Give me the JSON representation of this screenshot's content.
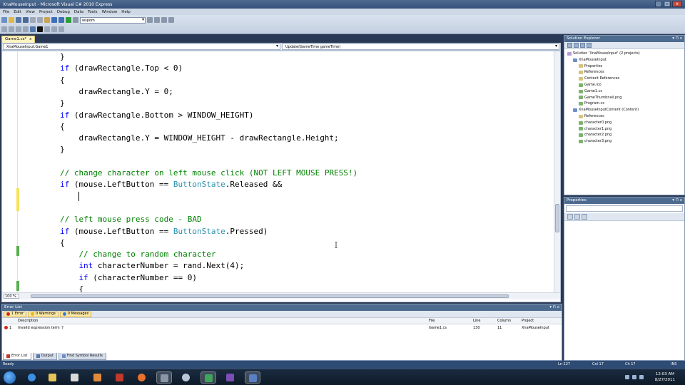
{
  "window": {
    "title": "XnaMouseInput - Microsoft Visual C# 2010 Express",
    "controls": [
      "_",
      "□",
      "x"
    ]
  },
  "menu": [
    "File",
    "Edit",
    "View",
    "Project",
    "Debug",
    "Data",
    "Tools",
    "Window",
    "Help"
  ],
  "toolbar": {
    "config_combo": "wspom"
  },
  "editor": {
    "tab_label": "Game1.cs*",
    "tab_close": "x",
    "nav_left": "XnaMouseInput.Game1",
    "nav_right": "Update(GameTime gameTime)",
    "zoom": "100 %",
    "lines": [
      {
        "indent": 8,
        "parts": [
          {
            "t": "}",
            "c": ""
          }
        ]
      },
      {
        "indent": 8,
        "parts": [
          {
            "t": "if",
            "c": "kw"
          },
          {
            "t": " (drawRectangle.Top < 0)",
            "c": ""
          }
        ]
      },
      {
        "indent": 8,
        "parts": [
          {
            "t": "{",
            "c": ""
          }
        ]
      },
      {
        "indent": 12,
        "parts": [
          {
            "t": "drawRectangle.Y = 0;",
            "c": ""
          }
        ]
      },
      {
        "indent": 8,
        "parts": [
          {
            "t": "}",
            "c": ""
          }
        ]
      },
      {
        "indent": 8,
        "parts": [
          {
            "t": "if",
            "c": "kw"
          },
          {
            "t": " (drawRectangle.Bottom > WINDOW_HEIGHT)",
            "c": ""
          }
        ]
      },
      {
        "indent": 8,
        "parts": [
          {
            "t": "{",
            "c": ""
          }
        ]
      },
      {
        "indent": 12,
        "parts": [
          {
            "t": "drawRectangle.Y = WINDOW_HEIGHT - drawRectangle.Height;",
            "c": ""
          }
        ]
      },
      {
        "indent": 8,
        "parts": [
          {
            "t": "}",
            "c": ""
          }
        ]
      },
      {
        "indent": 0,
        "parts": []
      },
      {
        "indent": 8,
        "parts": [
          {
            "t": "// change character on left mouse click (NOT LEFT MOUSE PRESS!)",
            "c": "cm"
          }
        ]
      },
      {
        "indent": 8,
        "parts": [
          {
            "t": "if",
            "c": "kw"
          },
          {
            "t": " (mouse.LeftButton == ",
            "c": ""
          },
          {
            "t": "ButtonState",
            "c": "ty"
          },
          {
            "t": ".Released &&",
            "c": ""
          }
        ]
      },
      {
        "indent": 12,
        "parts": [],
        "caret": true
      },
      {
        "indent": 0,
        "parts": []
      },
      {
        "indent": 8,
        "parts": [
          {
            "t": "// left mouse press code - BAD",
            "c": "cm"
          }
        ]
      },
      {
        "indent": 8,
        "parts": [
          {
            "t": "if",
            "c": "kw"
          },
          {
            "t": " (mouse.LeftButton == ",
            "c": ""
          },
          {
            "t": "ButtonState",
            "c": "ty"
          },
          {
            "t": ".Pressed)",
            "c": ""
          }
        ]
      },
      {
        "indent": 8,
        "parts": [
          {
            "t": "{",
            "c": ""
          }
        ]
      },
      {
        "indent": 12,
        "parts": [
          {
            "t": "// change to random character",
            "c": "cm"
          }
        ]
      },
      {
        "indent": 12,
        "parts": [
          {
            "t": "int",
            "c": "kw"
          },
          {
            "t": " characterNumber = rand.Next(4);",
            "c": ""
          }
        ]
      },
      {
        "indent": 12,
        "parts": [
          {
            "t": "if",
            "c": "kw"
          },
          {
            "t": " (characterNumber == 0)",
            "c": ""
          }
        ]
      },
      {
        "indent": 12,
        "parts": [
          {
            "t": "{",
            "c": ""
          }
        ]
      }
    ]
  },
  "solution_explorer": {
    "title": "Solution Explorer",
    "pin": "▾ ⊓ x",
    "items": [
      {
        "label": "Solution 'XnaMouseInput' (2 projects)",
        "indent": 0,
        "color": "#b69cd6"
      },
      {
        "label": "XnaMouseInput",
        "indent": 1,
        "color": "#6d8fc9"
      },
      {
        "label": "Properties",
        "indent": 2,
        "color": "#d8c27a"
      },
      {
        "label": "References",
        "indent": 2,
        "color": "#d8c27a"
      },
      {
        "label": "Content References",
        "indent": 2,
        "color": "#d8c27a"
      },
      {
        "label": "Game.ico",
        "indent": 2,
        "color": "#7bb36b"
      },
      {
        "label": "Game1.cs",
        "indent": 2,
        "color": "#7bb36b"
      },
      {
        "label": "GameThumbnail.png",
        "indent": 2,
        "color": "#7bb36b"
      },
      {
        "label": "Program.cs",
        "indent": 2,
        "color": "#7bb36b"
      },
      {
        "label": "XnaMouseInputContent (Content)",
        "indent": 1,
        "color": "#6d8fc9"
      },
      {
        "label": "References",
        "indent": 2,
        "color": "#d8c27a"
      },
      {
        "label": "character0.png",
        "indent": 2,
        "color": "#7bb36b"
      },
      {
        "label": "character1.png",
        "indent": 2,
        "color": "#7bb36b"
      },
      {
        "label": "character2.png",
        "indent": 2,
        "color": "#7bb36b"
      },
      {
        "label": "character3.png",
        "indent": 2,
        "color": "#7bb36b"
      }
    ]
  },
  "properties": {
    "title": "Properties",
    "pin": "▾ ⊓ x"
  },
  "error_list": {
    "title": "Error List",
    "pin": "▾ ⊓ x",
    "filters": [
      {
        "label": "1 Error",
        "color": "#d7261d",
        "active": true
      },
      {
        "label": "0 Warnings",
        "color": "#e8b923",
        "active": true
      },
      {
        "label": "0 Messages",
        "color": "#3a7fd4",
        "active": true
      }
    ],
    "columns": [
      "Description",
      "File",
      "Line",
      "Column",
      "Project"
    ],
    "rows": [
      {
        "num": "1",
        "description": "Invalid expression term ')'",
        "file": "Game1.cs",
        "line": "130",
        "column": "11",
        "project": "XnaMouseInput"
      }
    ]
  },
  "bottom_tabs": [
    "Error List",
    "Output",
    "Find Symbol Results"
  ],
  "status": {
    "left": "Ready",
    "ln": "Ln 127",
    "col": "Col 17",
    "ch": "Ch 17",
    "mode": "INS"
  },
  "taskbar": {
    "time": "12:03 AM",
    "date": "8/27/2011"
  }
}
